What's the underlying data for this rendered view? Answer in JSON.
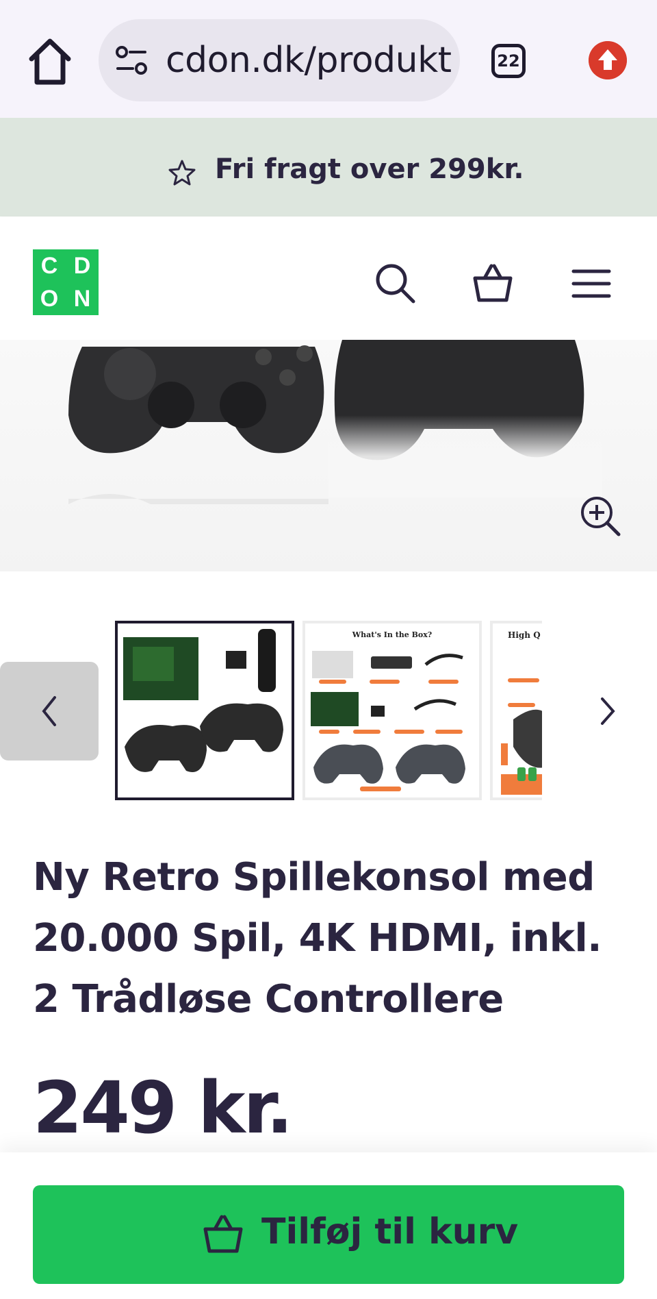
{
  "browser": {
    "url": "cdon.dk/produkt",
    "tab_count": "22"
  },
  "promo": {
    "text": "Fri fragt over 299kr."
  },
  "header": {
    "logo_letters": [
      "C",
      "D",
      "O",
      "N"
    ]
  },
  "gallery": {
    "thumbnails": [
      {
        "label": "",
        "selected": true
      },
      {
        "label": "What's In the Box?",
        "selected": false
      },
      {
        "label": "High Q",
        "selected": false
      }
    ]
  },
  "product": {
    "title": "Ny Retro Spillekonsol med 20.000 Spil, 4K HDMI, inkl. 2 Trådløse Controllere",
    "price": "249 kr."
  },
  "cart": {
    "add_label": "Tilføj til kurv"
  },
  "colors": {
    "brand_green": "#1ec25a",
    "text_dark": "#2b2540",
    "promo_bg": "#dde6de"
  }
}
